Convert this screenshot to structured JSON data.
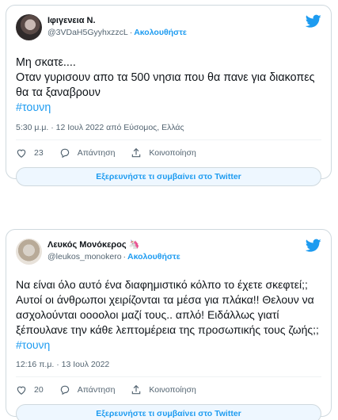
{
  "colors": {
    "accent": "#1d9bf0",
    "text": "#0f1419",
    "muted": "#536471",
    "border": "#cfd9de"
  },
  "tweets": [
    {
      "display_name": "Ιφιγενεια Ν.",
      "handle": "@3VDaH5GyyhxzzcL",
      "follow_label": "Ακολουθήστε",
      "text_main": "Μη σκατε....\nΟταν γυρισουν απο τα 500 νησια που θα πανε για διακοπες θα τα ξαναβρουν\n",
      "hashtag": "#τουνη",
      "meta": "5:30 μ.μ. · 12 Ιουλ 2022 από Εύσομος, Ελλάς",
      "like_count": "23",
      "reply_label": "Απάντηση",
      "share_label": "Κοινοποίηση",
      "explore_label": "Εξερευνήστε τι συμβαίνει στο Twitter"
    },
    {
      "display_name": "Λευκός Μονόκερος",
      "handle": "@leukos_monokero",
      "follow_label": "Ακολουθήστε",
      "text_main": "Να είναι όλο αυτό ένα διαφημιστικό κόλπο το έχετε σκεφτεί;; Αυτοί οι άνθρωποι χειρίζονται τα μέσα για πλάκα!! Θελουν να ασχολούνται οοοολοι μαζί τους.. απλό! Ειδάλλως γιατί ξέπουλανε την κάθε λεπτομέρεια της προσωπικής τους ζωής;; ",
      "hashtag": "#τουνη",
      "meta": "12:16 π.μ. · 13 Ιουλ 2022",
      "like_count": "20",
      "reply_label": "Απάντηση",
      "share_label": "Κοινοποίηση",
      "explore_label": "Εξερευνήστε τι συμβαίνει στο Twitter"
    }
  ]
}
